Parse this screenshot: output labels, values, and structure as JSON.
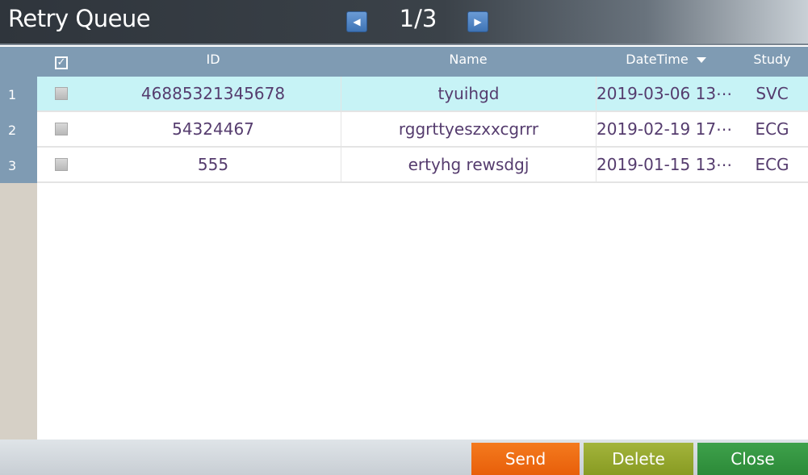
{
  "window": {
    "title": "Retry Queue",
    "page_indicator": "1/3",
    "prev_icon": "triangle-left-icon",
    "next_icon": "triangle-right-icon"
  },
  "table": {
    "columns": {
      "select_all": "☑",
      "id": "ID",
      "name": "Name",
      "datetime": "DateTime",
      "study": "Study"
    },
    "rows": [
      {
        "num": "1",
        "id": "46885321345678",
        "name": "tyuihgd",
        "datetime": "2019-03-06 13⋯",
        "study": "SVC",
        "selected": true
      },
      {
        "num": "2",
        "id": "54324467",
        "name": "rggrttyeszxxcgrrr",
        "datetime": "2019-02-19 17⋯",
        "study": "ECG",
        "selected": false
      },
      {
        "num": "3",
        "id": "555",
        "name": "ertyhg rewsdgj",
        "datetime": "2019-01-15 13⋯",
        "study": "ECG",
        "selected": false
      }
    ]
  },
  "buttons": {
    "send": "Send",
    "delete": "Delete",
    "close": "Close"
  },
  "colors": {
    "header_blue": "#7f9bb3",
    "selected_row": "#c7f3f6",
    "send": "#f47a1e",
    "delete": "#a3b43c",
    "close": "#3ea14b",
    "text": "#553c6e"
  }
}
